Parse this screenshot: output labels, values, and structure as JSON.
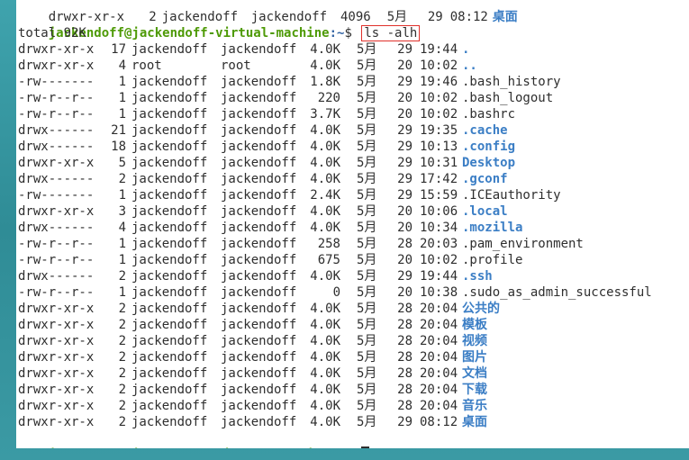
{
  "prompt": {
    "user_host": "jackendoff@jackendoff-virtual-machine",
    "path": ":~",
    "symbol": "$ "
  },
  "command": "ls -alh",
  "total": "total 92K",
  "top_partial": {
    "perm": "drwxr-xr-x",
    "links": "2",
    "user": "jackendoff",
    "group": "jackendoff",
    "size": "4096",
    "month": "5月",
    "day": "29",
    "time": "08:12",
    "name": "桌面"
  },
  "entries": [
    {
      "perm": "drwxr-xr-x",
      "links": "17",
      "user": "jackendoff",
      "group": "jackendoff",
      "size": "4.0K",
      "month": "5月",
      "day": "29",
      "time": "19:44",
      "name": ".",
      "dir": true
    },
    {
      "perm": "drwxr-xr-x",
      "links": "4",
      "user": "root",
      "group": "root",
      "size": "4.0K",
      "month": "5月",
      "day": "20",
      "time": "10:02",
      "name": "..",
      "dir": true
    },
    {
      "perm": "-rw-------",
      "links": "1",
      "user": "jackendoff",
      "group": "jackendoff",
      "size": "1.8K",
      "month": "5月",
      "day": "29",
      "time": "19:46",
      "name": ".bash_history",
      "dir": false
    },
    {
      "perm": "-rw-r--r--",
      "links": "1",
      "user": "jackendoff",
      "group": "jackendoff",
      "size": "220",
      "month": "5月",
      "day": "20",
      "time": "10:02",
      "name": ".bash_logout",
      "dir": false
    },
    {
      "perm": "-rw-r--r--",
      "links": "1",
      "user": "jackendoff",
      "group": "jackendoff",
      "size": "3.7K",
      "month": "5月",
      "day": "20",
      "time": "10:02",
      "name": ".bashrc",
      "dir": false
    },
    {
      "perm": "drwx------",
      "links": "21",
      "user": "jackendoff",
      "group": "jackendoff",
      "size": "4.0K",
      "month": "5月",
      "day": "29",
      "time": "19:35",
      "name": ".cache",
      "dir": true
    },
    {
      "perm": "drwx------",
      "links": "18",
      "user": "jackendoff",
      "group": "jackendoff",
      "size": "4.0K",
      "month": "5月",
      "day": "29",
      "time": "10:13",
      "name": ".config",
      "dir": true
    },
    {
      "perm": "drwxr-xr-x",
      "links": "5",
      "user": "jackendoff",
      "group": "jackendoff",
      "size": "4.0K",
      "month": "5月",
      "day": "29",
      "time": "10:31",
      "name": "Desktop",
      "dir": true
    },
    {
      "perm": "drwx------",
      "links": "2",
      "user": "jackendoff",
      "group": "jackendoff",
      "size": "4.0K",
      "month": "5月",
      "day": "29",
      "time": "17:42",
      "name": ".gconf",
      "dir": true
    },
    {
      "perm": "-rw-------",
      "links": "1",
      "user": "jackendoff",
      "group": "jackendoff",
      "size": "2.4K",
      "month": "5月",
      "day": "29",
      "time": "15:59",
      "name": ".ICEauthority",
      "dir": false
    },
    {
      "perm": "drwxr-xr-x",
      "links": "3",
      "user": "jackendoff",
      "group": "jackendoff",
      "size": "4.0K",
      "month": "5月",
      "day": "20",
      "time": "10:06",
      "name": ".local",
      "dir": true
    },
    {
      "perm": "drwx------",
      "links": "4",
      "user": "jackendoff",
      "group": "jackendoff",
      "size": "4.0K",
      "month": "5月",
      "day": "20",
      "time": "10:34",
      "name": ".mozilla",
      "dir": true
    },
    {
      "perm": "-rw-r--r--",
      "links": "1",
      "user": "jackendoff",
      "group": "jackendoff",
      "size": "258",
      "month": "5月",
      "day": "28",
      "time": "20:03",
      "name": ".pam_environment",
      "dir": false
    },
    {
      "perm": "-rw-r--r--",
      "links": "1",
      "user": "jackendoff",
      "group": "jackendoff",
      "size": "675",
      "month": "5月",
      "day": "20",
      "time": "10:02",
      "name": ".profile",
      "dir": false
    },
    {
      "perm": "drwx------",
      "links": "2",
      "user": "jackendoff",
      "group": "jackendoff",
      "size": "4.0K",
      "month": "5月",
      "day": "29",
      "time": "19:44",
      "name": ".ssh",
      "dir": true
    },
    {
      "perm": "-rw-r--r--",
      "links": "1",
      "user": "jackendoff",
      "group": "jackendoff",
      "size": "0",
      "month": "5月",
      "day": "20",
      "time": "10:38",
      "name": ".sudo_as_admin_successful",
      "dir": false
    },
    {
      "perm": "drwxr-xr-x",
      "links": "2",
      "user": "jackendoff",
      "group": "jackendoff",
      "size": "4.0K",
      "month": "5月",
      "day": "28",
      "time": "20:04",
      "name": "公共的",
      "dir": true
    },
    {
      "perm": "drwxr-xr-x",
      "links": "2",
      "user": "jackendoff",
      "group": "jackendoff",
      "size": "4.0K",
      "month": "5月",
      "day": "28",
      "time": "20:04",
      "name": "模板",
      "dir": true
    },
    {
      "perm": "drwxr-xr-x",
      "links": "2",
      "user": "jackendoff",
      "group": "jackendoff",
      "size": "4.0K",
      "month": "5月",
      "day": "28",
      "time": "20:04",
      "name": "视频",
      "dir": true
    },
    {
      "perm": "drwxr-xr-x",
      "links": "2",
      "user": "jackendoff",
      "group": "jackendoff",
      "size": "4.0K",
      "month": "5月",
      "day": "28",
      "time": "20:04",
      "name": "图片",
      "dir": true
    },
    {
      "perm": "drwxr-xr-x",
      "links": "2",
      "user": "jackendoff",
      "group": "jackendoff",
      "size": "4.0K",
      "month": "5月",
      "day": "28",
      "time": "20:04",
      "name": "文档",
      "dir": true
    },
    {
      "perm": "drwxr-xr-x",
      "links": "2",
      "user": "jackendoff",
      "group": "jackendoff",
      "size": "4.0K",
      "month": "5月",
      "day": "28",
      "time": "20:04",
      "name": "下载",
      "dir": true
    },
    {
      "perm": "drwxr-xr-x",
      "links": "2",
      "user": "jackendoff",
      "group": "jackendoff",
      "size": "4.0K",
      "month": "5月",
      "day": "28",
      "time": "20:04",
      "name": "音乐",
      "dir": true
    },
    {
      "perm": "drwxr-xr-x",
      "links": "2",
      "user": "jackendoff",
      "group": "jackendoff",
      "size": "4.0K",
      "month": "5月",
      "day": "29",
      "time": "08:12",
      "name": "桌面",
      "dir": true
    }
  ],
  "colors": {
    "prompt_user": "#4e9a06",
    "prompt_path": "#3465a4",
    "directory": "#3b7ec5",
    "highlight_box": "#e0302a",
    "desktop_bg": "#3a9aa4"
  }
}
